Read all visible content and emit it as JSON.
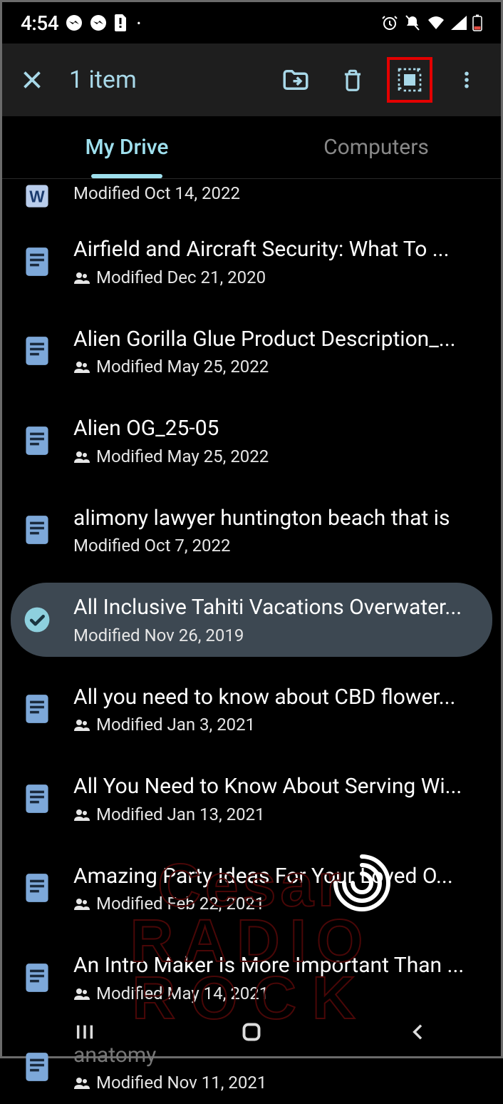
{
  "statusbar": {
    "clock": "4:54"
  },
  "toolbar": {
    "title": "1 item"
  },
  "tabs": {
    "my_drive": "My Drive",
    "computers": "Computers"
  },
  "files": [
    {
      "title": "",
      "meta": "Modified Oct 14, 2022",
      "shared": false,
      "icon": "word",
      "partial": true,
      "selected": false
    },
    {
      "title": "Airfield and Aircraft Security: What To ...",
      "meta": "Modified Dec 21, 2020",
      "shared": true,
      "icon": "doc",
      "selected": false
    },
    {
      "title": "Alien Gorilla Glue Product Description_...",
      "meta": "Modified May 25, 2022",
      "shared": true,
      "icon": "doc",
      "selected": false
    },
    {
      "title": "Alien OG_25-05",
      "meta": "Modified May 25, 2022",
      "shared": true,
      "icon": "doc",
      "selected": false
    },
    {
      "title": "alimony lawyer huntington beach that is",
      "meta": "Modified Oct 7, 2022",
      "shared": false,
      "icon": "doc",
      "selected": false
    },
    {
      "title": "All Inclusive Tahiti Vacations Overwater...",
      "meta": "Modified Nov 26, 2019",
      "shared": false,
      "icon": "check",
      "selected": true
    },
    {
      "title": "All you need to know about CBD flower...",
      "meta": "Modified Jan 3, 2021",
      "shared": true,
      "icon": "doc",
      "selected": false
    },
    {
      "title": "All You Need to Know About Serving Wi...",
      "meta": "Modified Jan 13, 2021",
      "shared": true,
      "icon": "doc",
      "selected": false
    },
    {
      "title": "Amazing Party Ideas For Your Loved O...",
      "meta": "Modified Feb 22, 2021",
      "shared": true,
      "icon": "doc",
      "selected": false
    },
    {
      "title": "An Intro Maker Is More Important Than ...",
      "meta": "Modified May 14, 2021",
      "shared": true,
      "icon": "doc",
      "selected": false
    },
    {
      "title": "anatomy",
      "meta": "Modified Nov 11, 2021",
      "shared": true,
      "icon": "doc",
      "selected": false,
      "grey": true
    }
  ],
  "watermark": {
    "line1": "Cesar",
    "line2": "RADIO",
    "line3": "ROCK"
  }
}
